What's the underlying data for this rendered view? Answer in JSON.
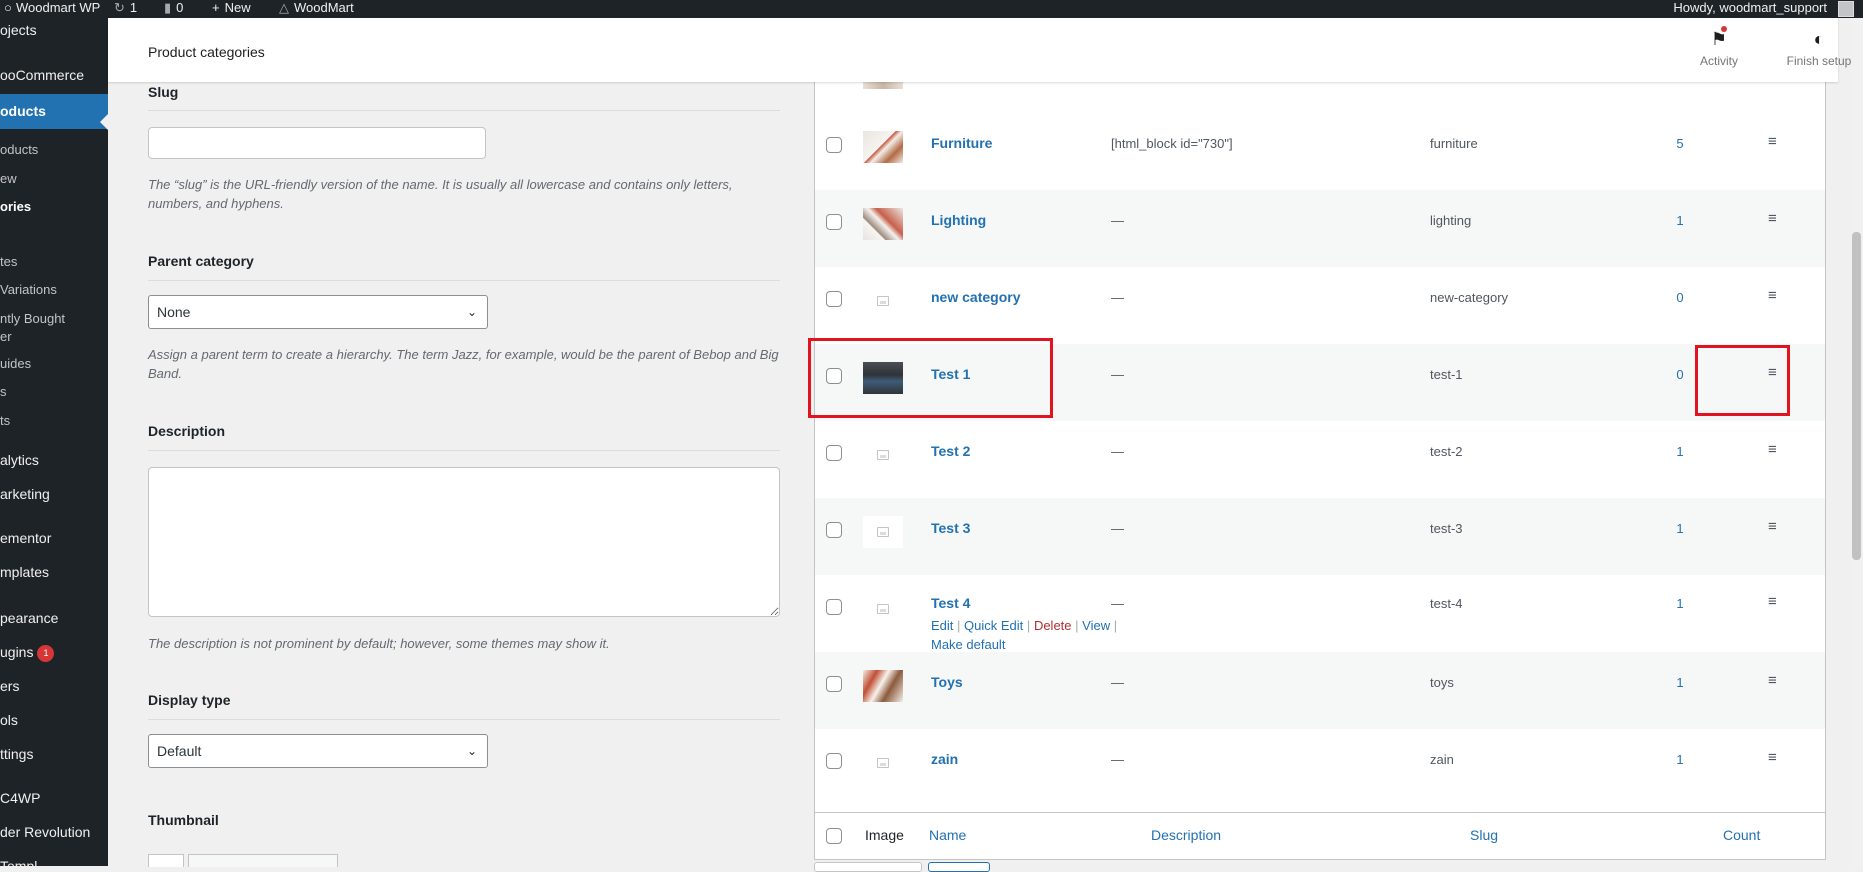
{
  "admin_bar": {
    "site_name": "Woodmart WP",
    "updates_count": "1",
    "comments_count": "0",
    "new_label": "New",
    "theme_label": "WoodMart",
    "howdy": "Howdy, woodmart_support"
  },
  "sidebar": {
    "items": [
      {
        "label": "ojects"
      },
      {
        "label": "ooCommerce"
      },
      {
        "label": "oducts"
      },
      {
        "label": "oducts"
      },
      {
        "label": "ew"
      },
      {
        "label": "ories"
      },
      {
        "label": "tes"
      },
      {
        "label": " Variations"
      },
      {
        "label": "ntly Bought"
      },
      {
        "label": "er"
      },
      {
        "label": "uides"
      },
      {
        "label": "s"
      },
      {
        "label": "ts"
      },
      {
        "label": "alytics"
      },
      {
        "label": "arketing"
      },
      {
        "label": "ementor"
      },
      {
        "label": "mplates"
      },
      {
        "label": "pearance"
      },
      {
        "label": "ugins",
        "badge": "1"
      },
      {
        "label": "ers"
      },
      {
        "label": "ols"
      },
      {
        "label": "ttings"
      },
      {
        "label": "C4WP"
      },
      {
        "label": "der Revolution"
      },
      {
        "label": "Templ..."
      }
    ]
  },
  "header": {
    "title": "Product categories",
    "activity_label": "Activity",
    "finish_setup_label": "Finish setup"
  },
  "form": {
    "slug_label": "Slug",
    "slug_value": "",
    "slug_hint": "The “slug” is the URL-friendly version of the name. It is usually all lowercase and contains only letters, numbers, and hyphens.",
    "parent_label": "Parent category",
    "parent_value": "None",
    "parent_hint": "Assign a parent term to create a hierarchy. The term Jazz, for example, would be the parent of Bebop and Big Band.",
    "description_label": "Description",
    "description_hint": "The description is not prominent by default; however, some themes may show it.",
    "display_type_label": "Display type",
    "display_type_value": "Default",
    "thumbnail_label": "Thumbnail"
  },
  "table": {
    "rows": [
      {
        "name": "Furniture",
        "description": "[html_block id=\"730\"]",
        "slug": "furniture",
        "count": "5",
        "thumb": "furn"
      },
      {
        "name": "Lighting",
        "description": "—",
        "slug": "lighting",
        "count": "1",
        "thumb": "light"
      },
      {
        "name": "new category",
        "description": "—",
        "slug": "new-category",
        "count": "0",
        "thumb": "ph"
      },
      {
        "name": "Test 1",
        "description": "—",
        "slug": "test-1",
        "count": "0",
        "thumb": "test1"
      },
      {
        "name": "Test 2",
        "description": "—",
        "slug": "test-2",
        "count": "1",
        "thumb": "ph"
      },
      {
        "name": "Test 3",
        "description": "—",
        "slug": "test-3",
        "count": "1",
        "thumb": "ph"
      },
      {
        "name": "Test 4",
        "description": "—",
        "slug": "test-4",
        "count": "1",
        "thumb": "ph"
      },
      {
        "name": "Toys",
        "description": "—",
        "slug": "toys",
        "count": "1",
        "thumb": "toys"
      },
      {
        "name": "zain",
        "description": "—",
        "slug": "zain",
        "count": "1",
        "thumb": "ph"
      }
    ],
    "row_actions": {
      "edit": "Edit",
      "quick_edit": "Quick Edit",
      "delete": "Delete",
      "view": "View",
      "make_default": "Make default"
    },
    "footer": {
      "image": "Image",
      "name": "Name",
      "description": "Description",
      "slug": "Slug",
      "count": "Count"
    }
  },
  "colors": {
    "admin_dark": "#1d2327",
    "accent_blue": "#2271b1",
    "highlight_red": "#e0131f",
    "delete_red": "#b32d2e"
  }
}
